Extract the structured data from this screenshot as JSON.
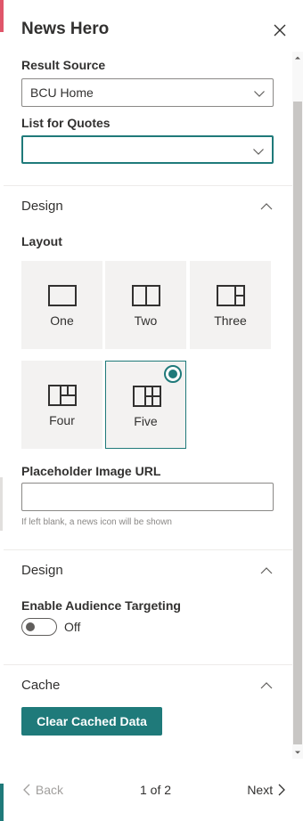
{
  "panel": {
    "title": "News Hero"
  },
  "result_source": {
    "label": "Result Source",
    "value": "BCU Home"
  },
  "list_for_quotes": {
    "label": "List for Quotes",
    "value": ""
  },
  "design_section": {
    "title": "Design",
    "layout_label": "Layout",
    "layouts": [
      {
        "label": "One",
        "selected": false
      },
      {
        "label": "Two",
        "selected": false
      },
      {
        "label": "Three",
        "selected": false
      },
      {
        "label": "Four",
        "selected": false
      },
      {
        "label": "Five",
        "selected": true
      }
    ],
    "placeholder_label": "Placeholder Image URL",
    "placeholder_value": "",
    "placeholder_hint": "If left blank, a news icon will be shown"
  },
  "design_section_2": {
    "title": "Design",
    "audience_label": "Enable Audience Targeting",
    "audience_state": "Off"
  },
  "cache_section": {
    "title": "Cache",
    "button_label": "Clear Cached Data"
  },
  "footer": {
    "back_label": "Back",
    "page_indicator": "1 of 2",
    "next_label": "Next"
  },
  "colors": {
    "accent": "#1f7a7a",
    "top_edge": "#e0566a"
  }
}
